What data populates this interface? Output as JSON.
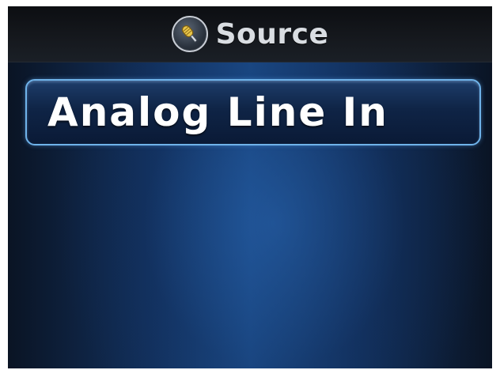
{
  "header": {
    "title": "Source",
    "icon": "microphone-icon"
  },
  "source": {
    "selected_label": "Analog Line In"
  },
  "colors": {
    "accent_border": "#6fb3ea",
    "background": "#12305c",
    "title_text": "#d9dde2"
  }
}
